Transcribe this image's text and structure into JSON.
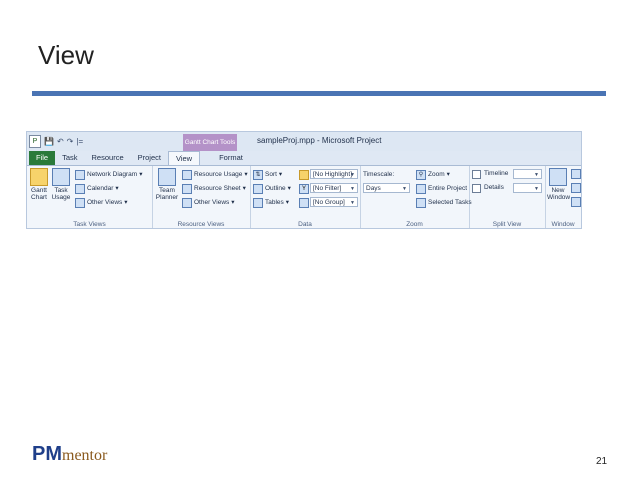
{
  "slide": {
    "title": "View",
    "page_number": "21"
  },
  "logo": {
    "pm": "PM",
    "mentor": "mentor"
  },
  "ribbon": {
    "window_title": "sampleProj.mpp  -  Microsoft Project",
    "contextual_tab": "Gantt Chart Tools",
    "qat": {
      "app_letter": "P",
      "customize": "|="
    },
    "tabs": [
      "File",
      "Task",
      "Resource",
      "Project",
      "View",
      "Format"
    ],
    "active_tab": "View",
    "groups": {
      "task_views": {
        "label": "Task Views",
        "gantt_chart": "Gantt Chart",
        "task_usage": "Task Usage",
        "network_diagram": "Network Diagram",
        "calendar": "Calendar",
        "other_views": "Other Views"
      },
      "resource_views": {
        "label": "Resource Views",
        "team_planner": "Team Planner",
        "resource_usage": "Resource Usage",
        "resource_sheet": "Resource Sheet",
        "other_views": "Other Views"
      },
      "data": {
        "label": "Data",
        "sort": "Sort",
        "outline": "Outline",
        "tables": "Tables",
        "highlight": "[No Highlight]",
        "filter": "[No Filter]",
        "group": "[No Group]"
      },
      "zoom": {
        "label": "Zoom",
        "timescale_label": "Timescale:",
        "timescale_value": "Days",
        "zoom": "Zoom",
        "entire_project": "Entire Project",
        "selected_tasks": "Selected Tasks"
      },
      "split_view": {
        "label": "Split View",
        "timeline": "Timeline",
        "details": "Details"
      },
      "window": {
        "label": "Window",
        "new_window": "New Window"
      }
    }
  }
}
